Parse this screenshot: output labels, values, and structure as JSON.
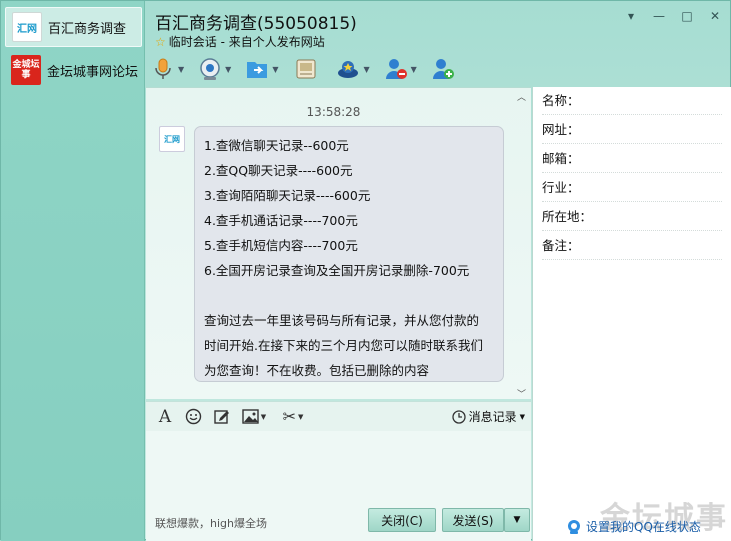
{
  "window": {
    "title": "百汇商务调查(55050815)",
    "subtitle": "临时会话 - 来自个人发布网站",
    "controls": [
      "▾",
      "—",
      "□",
      "✕"
    ]
  },
  "sidebar": {
    "items": [
      {
        "label": "百汇商务调查",
        "avatar_text": "汇网",
        "active": true
      },
      {
        "label": "金坛城事网论坛",
        "avatar_text": "金城坛事",
        "active": false
      }
    ]
  },
  "toolbar": {
    "buttons": [
      "microphone-icon",
      "camera-icon",
      "file-transfer-icon",
      "remote-desktop-icon",
      "app-icon",
      "block-user-icon",
      "add-user-icon"
    ]
  },
  "chat": {
    "timestamp": "13:58:28",
    "sender_avatar_text": "汇网",
    "message_lines": [
      "1.查微信聊天记录--600元",
      "2.查QQ聊天记录----600元",
      "3.查询陌陌聊天记录----600元",
      "4.查手机通话记录----700元",
      "5.查手机短信内容----700元",
      "6.全国开房记录查询及全国开房记录删除-700元",
      "",
      "查询过去一年里该号码与所有记录，并从您付款的",
      "时间开始.在接下来的三个月内您可以随时联系我们",
      "为您查询！不在收费。包括已删除的内容"
    ]
  },
  "input_toolbar": {
    "message_record_label": "消息记录"
  },
  "input": {
    "hint": "联想爆款，high爆全场",
    "close_label": "关闭(C)",
    "send_label": "发送(S)"
  },
  "profile": {
    "fields": [
      "名称：",
      "网址：",
      "邮箱：",
      "行业：",
      "所在地：",
      "备注："
    ],
    "status_link": "设置我的QQ在线状态"
  },
  "watermark": "金坛城事",
  "colors": {
    "accent": "#8fd5c6",
    "link": "#1a5ea8",
    "bubble": "#e2e6ec"
  }
}
